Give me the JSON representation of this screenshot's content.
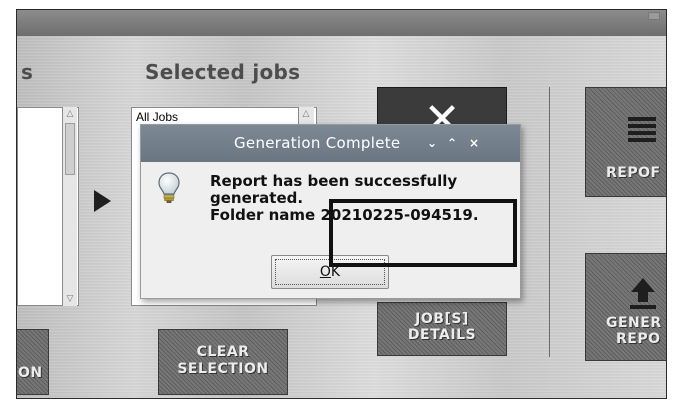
{
  "headings": {
    "left_partial": "s",
    "selected_jobs": "Selected jobs"
  },
  "selected_list": {
    "items": [
      "All Jobs"
    ]
  },
  "buttons": {
    "report_partial": "REPOF",
    "generate_partial_line1": "GENER",
    "generate_partial_line2": "REPO",
    "job_details_line1": "JOB[S]",
    "job_details_line2": "DETAILS",
    "clear_selection_line1": "CLEAR",
    "clear_selection_line2": "SELECTION",
    "left_partial": "ON"
  },
  "icons": {
    "delete": "close-x-icon",
    "report": "list-icon",
    "generate": "upload-icon",
    "move_right": "arrow-right-icon",
    "dialog_info": "lightbulb-icon"
  },
  "dialog": {
    "title": "Generation Complete",
    "controls": {
      "minimize": "⌄",
      "maximize": "⌃",
      "close": "×"
    },
    "message_line1": "Report has been successfully",
    "message_line2": "generated.",
    "message_line3_label": "Folder name",
    "folder_name": "20210225-094519.",
    "ok_underlined": "O",
    "ok_rest": "K"
  },
  "colors": {
    "dialog_titlebar": "#6f7b87",
    "highlight_border": "#111111"
  }
}
